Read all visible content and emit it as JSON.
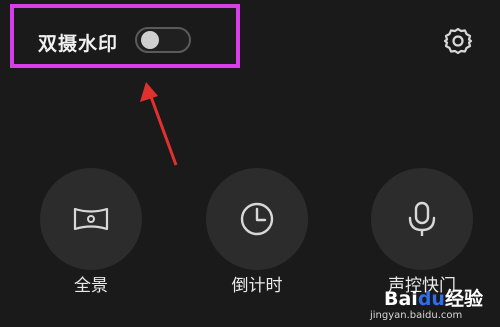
{
  "top_bar": {
    "dual_watermark_label": "双摄水印",
    "dual_watermark_enabled": false,
    "settings_icon": "gear-icon"
  },
  "annotation": {
    "highlight_color": "#d63ee8",
    "arrow_color": "#e0312f"
  },
  "modes": [
    {
      "label": "全景",
      "icon": "panorama-icon"
    },
    {
      "label": "倒计时",
      "icon": "clock-icon"
    },
    {
      "label": "声控快门",
      "icon": "microphone-icon"
    }
  ],
  "watermark": {
    "logo_text_prefix": "Bai",
    "logo_text_suffix": "经验",
    "url": "jingyan.baidu.com"
  }
}
